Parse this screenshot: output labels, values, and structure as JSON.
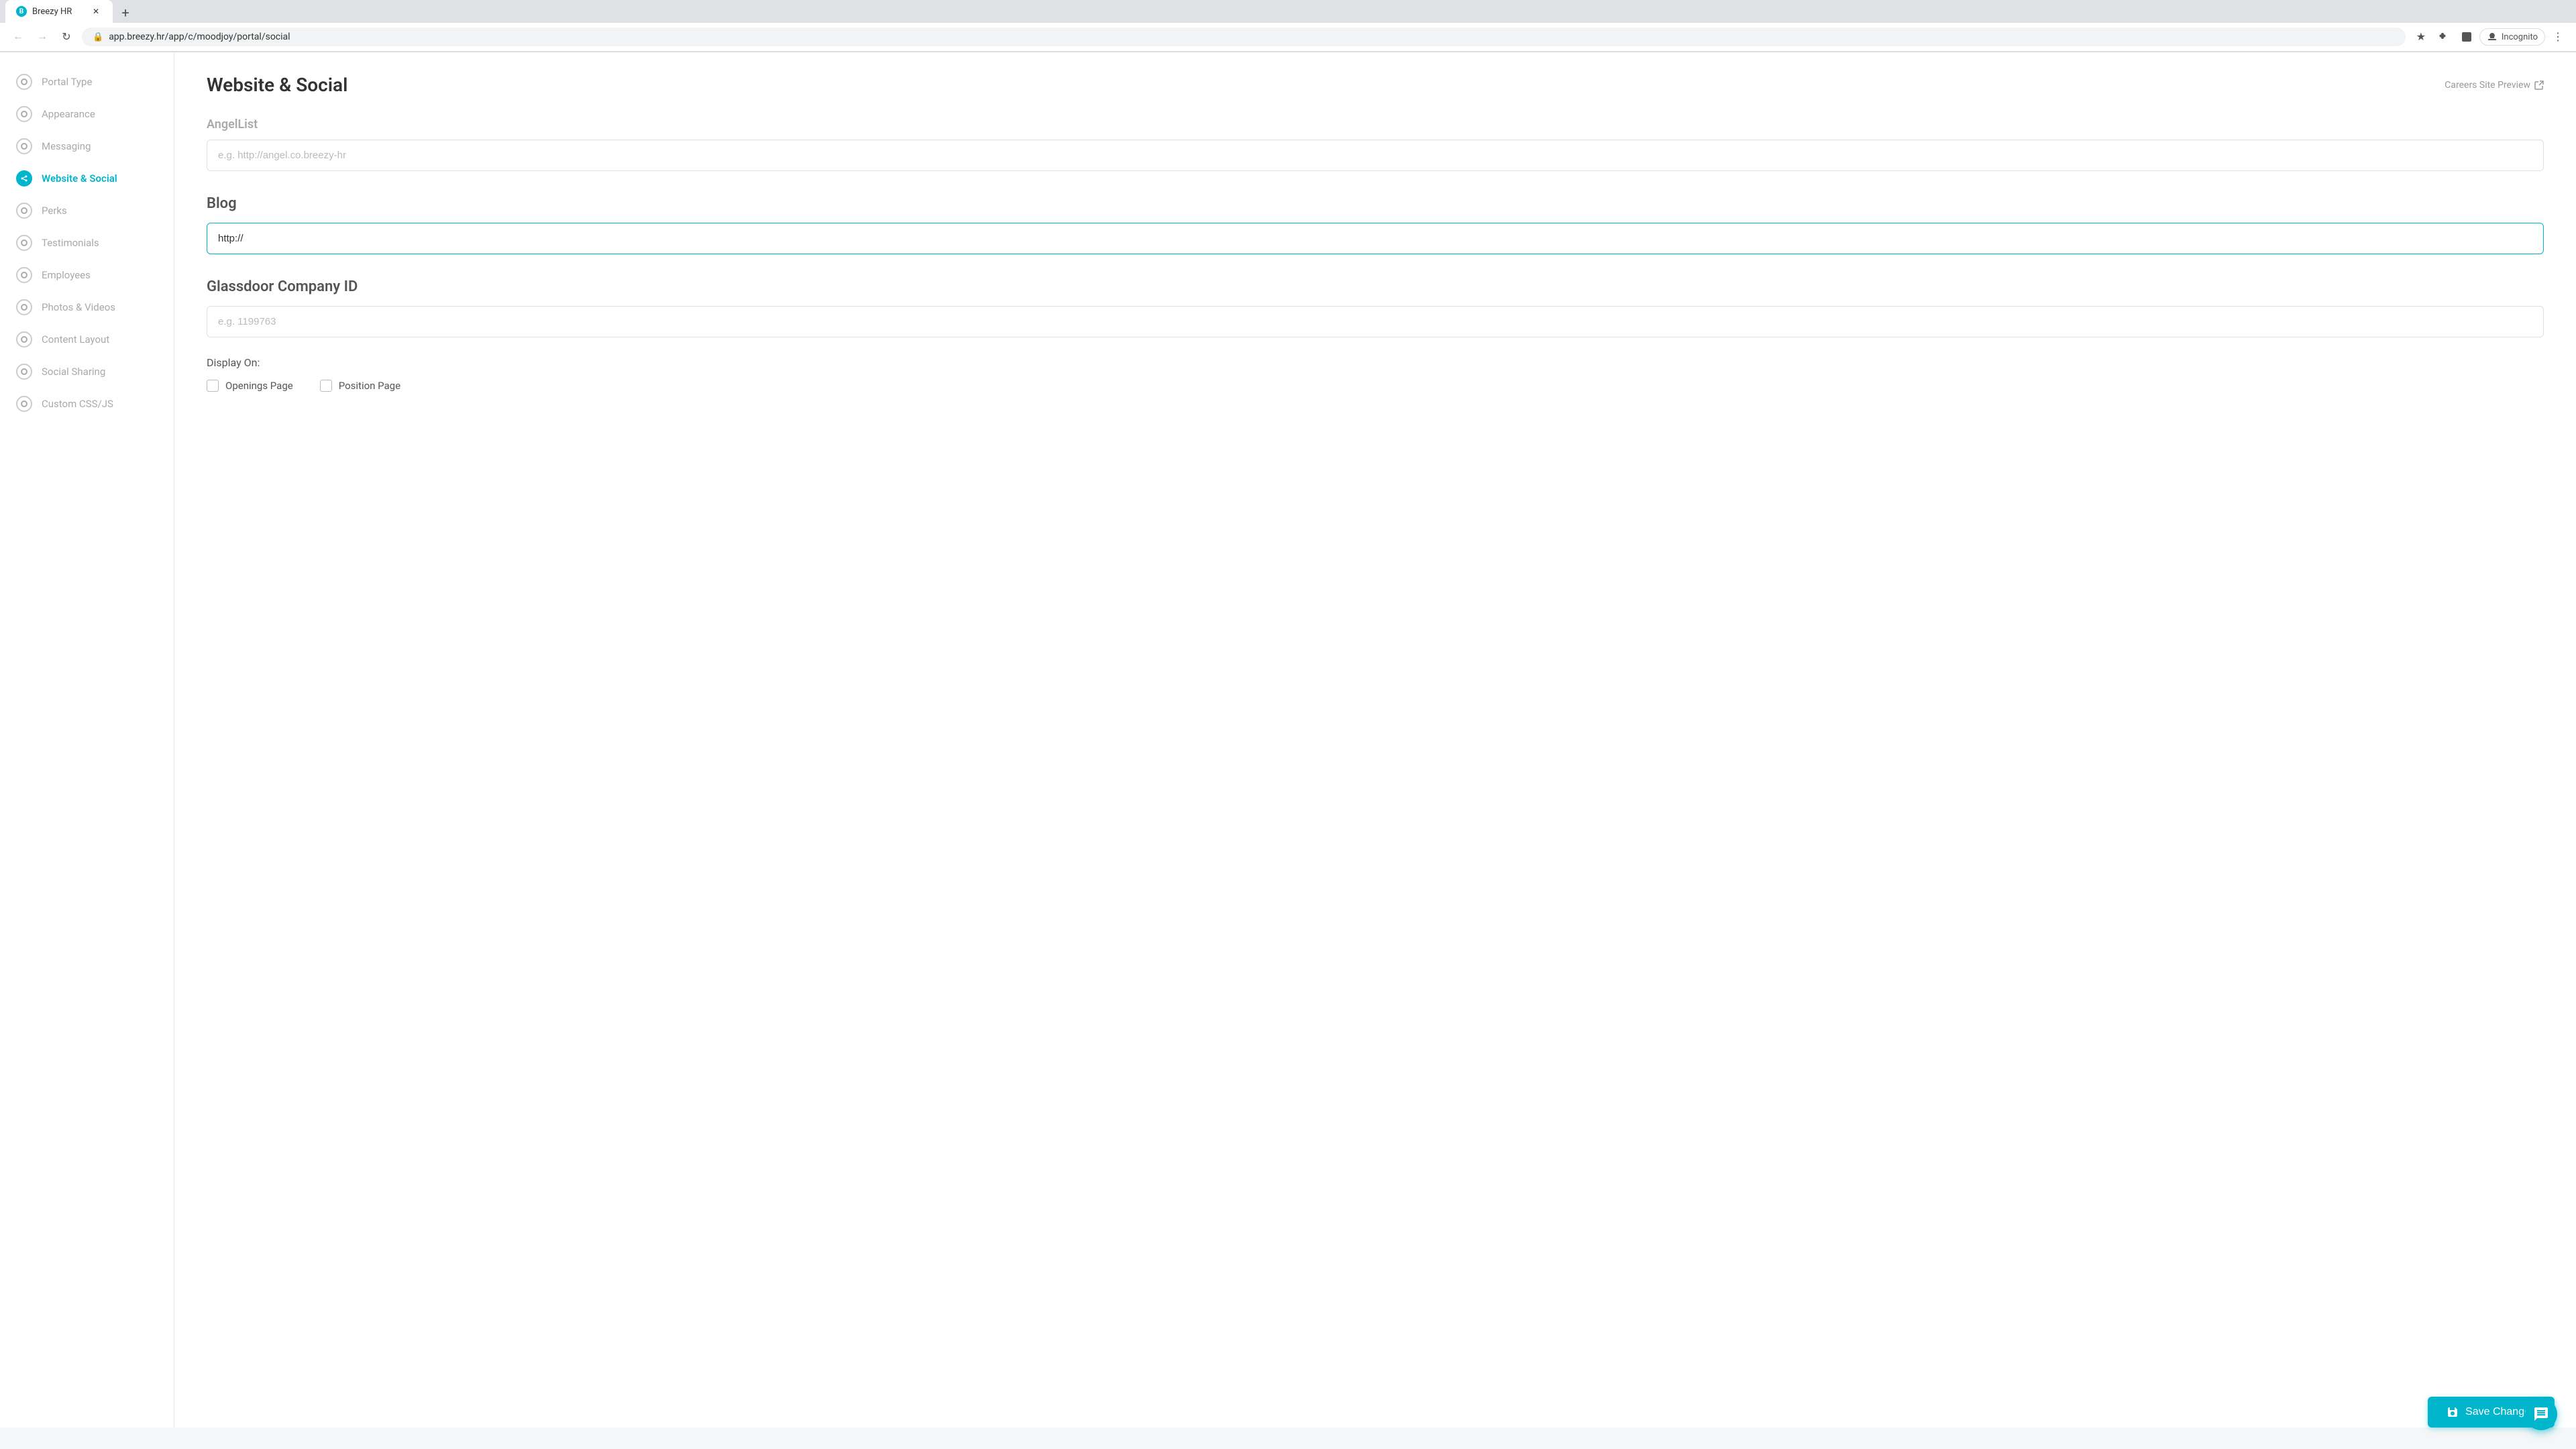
{
  "browser": {
    "tab_title": "Breezy HR",
    "url": "app.breezy.hr/app/c/moodjoy/portal/social",
    "incognito_label": "Incognito"
  },
  "sidebar": {
    "items": [
      {
        "id": "portal-type",
        "label": "Portal Type",
        "active": false,
        "icon": "circle"
      },
      {
        "id": "appearance",
        "label": "Appearance",
        "active": false,
        "icon": "circle"
      },
      {
        "id": "messaging",
        "label": "Messaging",
        "active": false,
        "icon": "circle"
      },
      {
        "id": "website-social",
        "label": "Website & Social",
        "active": true,
        "icon": "share"
      },
      {
        "id": "perks",
        "label": "Perks",
        "active": false,
        "icon": "circle"
      },
      {
        "id": "testimonials",
        "label": "Testimonials",
        "active": false,
        "icon": "circle"
      },
      {
        "id": "employees",
        "label": "Employees",
        "active": false,
        "icon": "circle"
      },
      {
        "id": "photos-videos",
        "label": "Photos & Videos",
        "active": false,
        "icon": "circle"
      },
      {
        "id": "content-layout",
        "label": "Content Layout",
        "active": false,
        "icon": "circle"
      },
      {
        "id": "social-sharing",
        "label": "Social Sharing",
        "active": false,
        "icon": "circle"
      },
      {
        "id": "custom-css-js",
        "label": "Custom CSS/JS",
        "active": false,
        "icon": "circle"
      }
    ]
  },
  "page": {
    "title": "Website & Social",
    "careers_preview_label": "Careers Site Preview"
  },
  "form": {
    "angellist_section": "AngelList",
    "angellist_placeholder": "e.g. http://angel.co.breezy-hr",
    "angellist_value": "",
    "blog_section": "Blog",
    "blog_placeholder": "",
    "blog_value": "http://",
    "glassdoor_section": "Glassdoor Company ID",
    "glassdoor_placeholder": "e.g. 1199763",
    "glassdoor_value": "",
    "display_on_label": "Display On:",
    "checkboxes": [
      {
        "id": "openings-page",
        "label": "Openings Page",
        "checked": false
      },
      {
        "id": "position-page",
        "label": "Position Page",
        "checked": false
      }
    ],
    "save_button_label": "Save Changes"
  }
}
